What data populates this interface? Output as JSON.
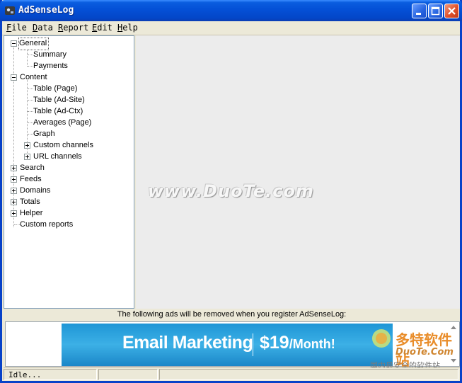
{
  "window": {
    "title": "AdSenseLog"
  },
  "menu": [
    {
      "label": "File",
      "u": "F",
      "rest": "ile"
    },
    {
      "label": "Data",
      "u": "D",
      "rest": "ata"
    },
    {
      "label": "Report",
      "u": "R",
      "rest": "eport"
    },
    {
      "label": "Edit",
      "u": "E",
      "rest": "dit"
    },
    {
      "label": "Help",
      "u": "H",
      "rest": "elp"
    }
  ],
  "tree": {
    "general": "General",
    "summary": "Summary",
    "payments": "Payments",
    "content": "Content",
    "table_page": "Table (Page)",
    "table_adsite": "Table (Ad-Site)",
    "table_adctx": "Table (Ad-Ctx)",
    "averages_page": "Averages (Page)",
    "graph": "Graph",
    "custom_channels": "Custom channels",
    "url_channels": "URL channels",
    "search": "Search",
    "feeds": "Feeds",
    "domains": "Domains",
    "totals": "Totals",
    "helper": "Helper",
    "custom_reports": "Custom reports"
  },
  "watermark": "www.DuoTe.com",
  "ads": {
    "notice": "The following ads will be removed when you register AdSenseLog:",
    "banner_title": "Email Marketing",
    "banner_price": "$19",
    "banner_price_unit": "/Month!"
  },
  "site_logo": {
    "line1": "多特软件站",
    "line2": "DuoTe.Com",
    "line3": "国内最安全的软件站"
  },
  "status": {
    "text": "Idle..."
  }
}
